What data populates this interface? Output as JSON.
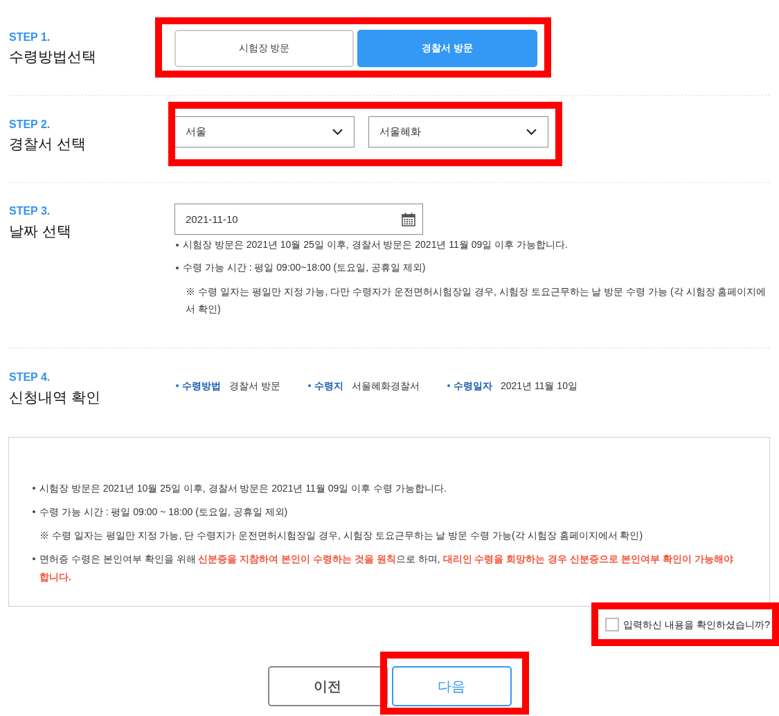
{
  "steps": [
    {
      "kind": "method",
      "step": "STEP 1.",
      "title": "수령방법선택",
      "highlighted": true,
      "options": [
        {
          "label": "시험장 방문",
          "selected": false
        },
        {
          "label": "경찰서 방문",
          "selected": true
        }
      ]
    },
    {
      "kind": "station",
      "step": "STEP 2.",
      "title": "경찰서 선택",
      "highlighted": true,
      "selects": [
        {
          "value": "서울"
        },
        {
          "value": "서울혜화"
        }
      ]
    },
    {
      "kind": "date",
      "step": "STEP 3.",
      "title": "날짜 선택",
      "date": "2021-11-10",
      "notes": [
        {
          "kind": "bullet",
          "text": "시험장 방문은 2021년 10월 25일 이후, 경찰서 방문은 2021년 11월 09일 이후 가능합니다."
        },
        {
          "kind": "bullet",
          "text": "수령 가능 시간 : 평일 09:00~18:00 (토요일, 공휴일 제외)"
        },
        {
          "kind": "remark",
          "text": "※ 수령 일자는 평일만 지정 가능, 다만 수령자가 운전면허시험장일 경우, 시험장 토요근무하는 날 방문 수령 가능 (각 시험장 홈페이지에서 확인)"
        }
      ]
    },
    {
      "kind": "summary",
      "step": "STEP 4.",
      "title": "신청내역 확인",
      "items": [
        {
          "label": "수령방법",
          "value": "경찰서 방문"
        },
        {
          "label": "수령지",
          "value": "서울혜화경찰서"
        },
        {
          "label": "수령일자",
          "value": "2021년 11월 10일"
        }
      ]
    }
  ],
  "notice": {
    "notes": [
      {
        "kind": "bullet",
        "text": "시험장 방문은 2021년 10월 25일 이후, 경찰서 방문은 2021년 11월 09일 이후 수령 가능합니다."
      },
      {
        "kind": "bullet",
        "text": "수령 가능 시간 : 평일 09:00 ~ 18:00 (토요일, 공휴일 제외)"
      },
      {
        "kind": "remark",
        "text": "※ 수령 일자는 평일만 지정 가능, 단 수령지가 운전면허시험장일 경우, 시험장 토요근무하는 날 방문 수령 가능(각 시험장 홈페이지에서 확인)"
      },
      {
        "kind": "bullet",
        "text": "면허증 수령은 본인여부 확인을 위해 **신분증을 지참하여 본인이 수령하는 것을 원칙**으로 하며, **대리인 수령을 희망하는 경우 신분증으로 본인여부 확인이 가능해야 합니다.**"
      }
    ]
  },
  "confirm": {
    "label": "입력하신 내용을 확인하셨습니까?",
    "checked": false,
    "highlighted": true
  },
  "buttons": [
    {
      "label": "이전",
      "kind": "secondary"
    },
    {
      "label": "다음",
      "kind": "primary",
      "highlighted": true
    }
  ]
}
